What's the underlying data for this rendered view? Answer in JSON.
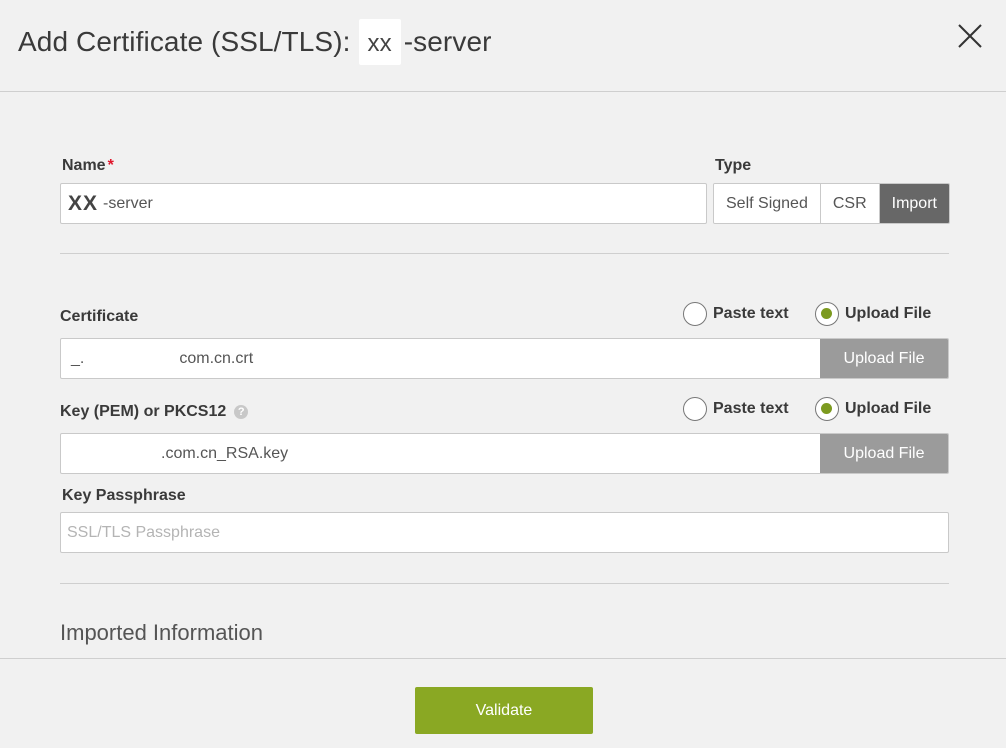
{
  "dialog": {
    "title_prefix": "Add Certificate (SSL/TLS):",
    "title_chip": "xx",
    "title_suffix": "-server",
    "close_icon": "close-icon"
  },
  "name_field": {
    "label": "Name",
    "required_mark": "*",
    "value_bold": "XX",
    "value_rest": "-server"
  },
  "type_selector": {
    "label": "Type",
    "options": [
      "Self Signed",
      "CSR",
      "Import"
    ],
    "selected": "Import"
  },
  "certificate": {
    "label": "Certificate",
    "radio_paste": "Paste text",
    "radio_upload": "Upload File",
    "selected": "Upload File",
    "file_prefix": "_.",
    "file_suffix": "com.cn.crt",
    "button": "Upload File"
  },
  "key": {
    "label": "Key (PEM) or PKCS12",
    "help_icon": "question-icon",
    "radio_paste": "Paste text",
    "radio_upload": "Upload File",
    "selected": "Upload File",
    "file_value": ".com.cn_RSA.key",
    "button": "Upload File"
  },
  "passphrase": {
    "label": "Key Passphrase",
    "placeholder": "SSL/TLS Passphrase"
  },
  "imported_info": {
    "title": "Imported Information"
  },
  "footer": {
    "validate_label": "Validate"
  },
  "colors": {
    "accent_green": "#8aa823",
    "radio_green": "#7c9a1f",
    "required_red": "#e0162b",
    "active_segment": "#676767",
    "upload_button": "#9b9b9b"
  }
}
